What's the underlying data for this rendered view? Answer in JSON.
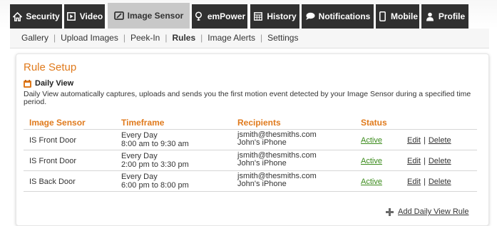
{
  "tabs": [
    {
      "label": "Security",
      "icon": "home-icon",
      "active": false
    },
    {
      "label": "Video",
      "icon": "video-play-icon",
      "active": false
    },
    {
      "label": "Image Sensor",
      "icon": "image-sensor-icon",
      "active": true
    },
    {
      "label": "emPower",
      "icon": "lightbulb-icon",
      "active": false
    },
    {
      "label": "History",
      "icon": "calendar-grid-icon",
      "active": false
    },
    {
      "label": "Notifications",
      "icon": "speech-bubble-icon",
      "active": false
    },
    {
      "label": "Mobile",
      "icon": "mobile-phone-icon",
      "active": false
    },
    {
      "label": "Profile",
      "icon": "user-icon",
      "active": false
    }
  ],
  "subnav": {
    "items": [
      "Gallery",
      "Upload Images",
      "Peek-In",
      "Rules",
      "Image Alerts",
      "Settings"
    ],
    "current": "Rules"
  },
  "page": {
    "title": "Rule Setup",
    "section_title": "Daily View",
    "section_icon": "calendar-icon",
    "description": "Daily View automatically captures, uploads and sends you the first motion event detected by your Image Sensor during a specified time period."
  },
  "table": {
    "headers": {
      "sensor": "Image Sensor",
      "timeframe": "Timeframe",
      "recipients": "Recipients",
      "status": "Status"
    },
    "rows": [
      {
        "sensor": "IS Front Door",
        "time1": "Every Day",
        "time2": "8:00 am to 9:30 am",
        "recip1": "jsmith@thesmiths.com",
        "recip2": "John's iPhone",
        "status": "Active",
        "edit": "Edit",
        "sep": "|",
        "delete": "Delete"
      },
      {
        "sensor": "IS Front Door",
        "time1": "Every Day",
        "time2": "2:00 pm to 3:30 pm",
        "recip1": "jsmith@thesmiths.com",
        "recip2": "John's iPhone",
        "status": "Active",
        "edit": "Edit",
        "sep": "|",
        "delete": "Delete"
      },
      {
        "sensor": "IS Back Door",
        "time1": "Every Day",
        "time2": "6:00 pm to 8:00 pm",
        "recip1": "jsmith@thesmiths.com",
        "recip2": "John's iPhone",
        "status": "Active",
        "edit": "Edit",
        "sep": "|",
        "delete": "Delete"
      }
    ]
  },
  "add_rule": {
    "label": "Add Daily View Rule",
    "icon": "plus-icon"
  },
  "colors": {
    "accent": "#e07a1c",
    "tab_bg": "#303030",
    "tab_active_bg": "#c8c8c8",
    "status_active": "#3a8a1a"
  }
}
